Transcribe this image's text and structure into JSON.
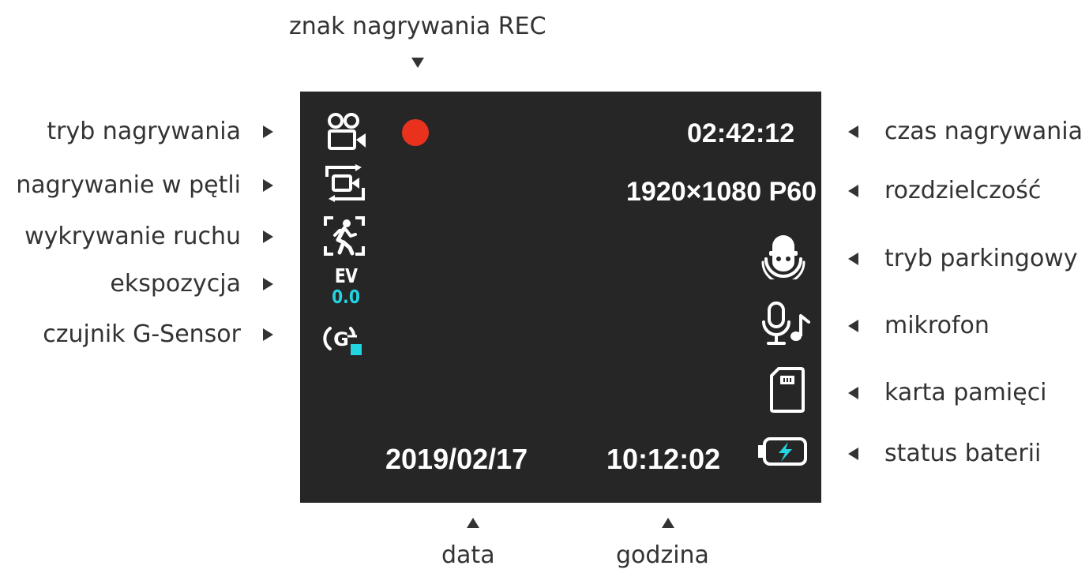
{
  "labels": {
    "rec_indicator": "znak nagrywania REC",
    "recording_mode": "tryb nagrywania",
    "loop_recording": "nagrywanie w pętli",
    "motion_detection": "wykrywanie ruchu",
    "exposure": "ekspozycja",
    "g_sensor": "czujnik G-Sensor",
    "recording_time": "czas nagrywania",
    "resolution": "rozdzielczość",
    "parking_mode": "tryb parkingowy",
    "microphone": "mikrofon",
    "memory_card": "karta pamięci",
    "battery_status": "status baterii",
    "date": "data",
    "time": "godzina"
  },
  "screen": {
    "recording_time": "02:42:12",
    "resolution": "1920×1080 P60",
    "ev_label": "EV",
    "ev_value": "0.0",
    "date": "2019/02/17",
    "time": "10:12:02",
    "g_sensor_letter": "G"
  },
  "colors": {
    "screen_background": "#262626",
    "rec_dot": "#e8321e",
    "accent_cyan": "#22d3e0",
    "callout_text": "#333333"
  },
  "icons": {
    "recording_mode": "video-camera-icon",
    "loop_recording": "loop-recording-icon",
    "motion_detection": "motion-detection-icon",
    "g_sensor": "g-sensor-icon",
    "parking_mode": "parking-mode-icon",
    "microphone": "microphone-music-icon",
    "memory_card": "sd-card-icon",
    "battery_status": "battery-charging-icon"
  }
}
